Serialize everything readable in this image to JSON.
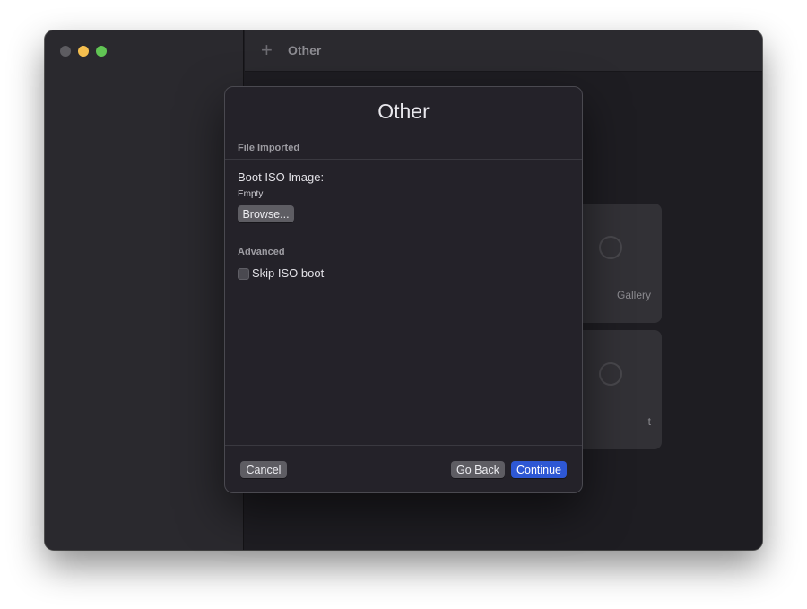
{
  "window": {
    "title": "Other",
    "add_icon": "plus-icon"
  },
  "background_cards": [
    {
      "label": "Gallery"
    },
    {
      "label": "t"
    }
  ],
  "dialog": {
    "title": "Other",
    "file_section": {
      "header": "File Imported",
      "boot_iso_label": "Boot ISO Image:",
      "boot_iso_value": "Empty",
      "browse_label": "Browse..."
    },
    "advanced_section": {
      "header": "Advanced",
      "skip_iso_label": "Skip ISO boot",
      "skip_iso_checked": false
    },
    "footer": {
      "cancel_label": "Cancel",
      "back_label": "Go Back",
      "continue_label": "Continue"
    }
  },
  "colors": {
    "accent": "#2e58d4",
    "traffic_close": "#5d5c61",
    "traffic_minimize": "#f5bf4f",
    "traffic_maximize": "#61c554"
  }
}
